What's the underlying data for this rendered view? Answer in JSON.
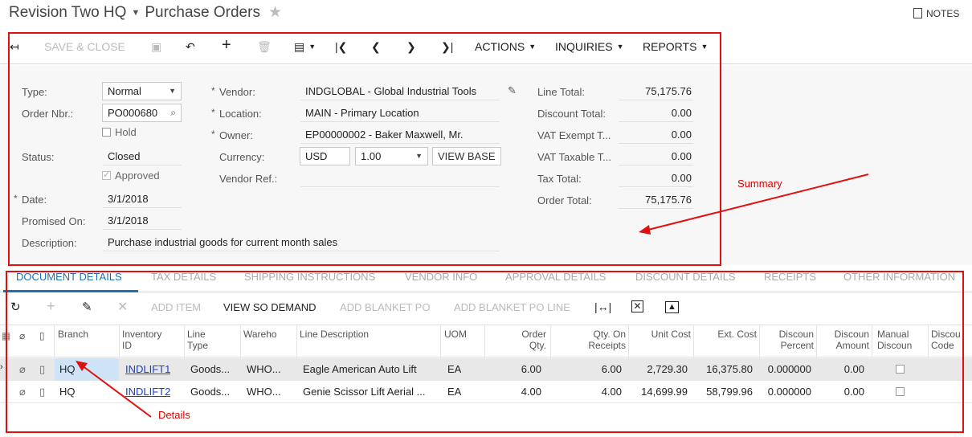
{
  "header": {
    "company": "Revision Two HQ",
    "screen": "Purchase Orders",
    "notes_label": "NOTES"
  },
  "toolbar": {
    "save_close": "SAVE & CLOSE",
    "actions": "ACTIONS",
    "inquiries": "INQUIRIES",
    "reports": "REPORTS"
  },
  "summary": {
    "type_label": "Type:",
    "type_value": "Normal",
    "order_nbr_label": "Order Nbr.:",
    "order_nbr_value": "PO000680",
    "hold_label": "Hold",
    "status_label": "Status:",
    "status_value": "Closed",
    "approved_label": "Approved",
    "date_label": "Date:",
    "date_value": "3/1/2018",
    "promised_label": "Promised On:",
    "promised_value": "3/1/2018",
    "description_label": "Description:",
    "description_value": "Purchase industrial goods for current month sales",
    "vendor_label": "Vendor:",
    "vendor_value": "INDGLOBAL - Global Industrial Tools",
    "location_label": "Location:",
    "location_value": "MAIN - Primary Location",
    "owner_label": "Owner:",
    "owner_value": "EP00000002 - Baker Maxwell, Mr.",
    "currency_label": "Currency:",
    "currency_value": "USD",
    "rate_value": "1.00",
    "view_base": "VIEW BASE",
    "vendor_ref_label": "Vendor Ref.:",
    "line_total_label": "Line Total:",
    "line_total_value": "75,175.76",
    "discount_total_label": "Discount Total:",
    "discount_total_value": "0.00",
    "vat_exempt_label": "VAT Exempt T...",
    "vat_exempt_value": "0.00",
    "vat_taxable_label": "VAT Taxable T...",
    "vat_taxable_value": "0.00",
    "tax_total_label": "Tax Total:",
    "tax_total_value": "0.00",
    "order_total_label": "Order Total:",
    "order_total_value": "75,175.76"
  },
  "tabs": [
    "DOCUMENT DETAILS",
    "TAX DETAILS",
    "SHIPPING INSTRUCTIONS",
    "VENDOR INFO",
    "APPROVAL DETAILS",
    "DISCOUNT DETAILS",
    "RECEIPTS",
    "OTHER INFORMATION"
  ],
  "grid_toolbar": {
    "add_item": "ADD ITEM",
    "view_so_demand": "VIEW SO DEMAND",
    "add_blanket_po": "ADD BLANKET PO",
    "add_blanket_po_line": "ADD BLANKET PO LINE"
  },
  "grid": {
    "headers": [
      "Branch",
      "Inventory\nID",
      "Line\nType",
      "Wareho",
      "Line Description",
      "UOM",
      "Order\nQty.",
      "Qty. On\nReceipts",
      "Unit Cost",
      "Ext. Cost",
      "Discoun\nPercent",
      "Discoun\nAmount",
      "Manual\nDiscoun",
      "Discou\nCode"
    ],
    "rows": [
      {
        "branch": "HQ",
        "inventory_id": "INDLIFT1",
        "line_type": "Goods...",
        "warehouse": "WHO...",
        "description": "Eagle American Auto Lift",
        "uom": "EA",
        "order_qty": "6.00",
        "qty_receipts": "6.00",
        "unit_cost": "2,729.30",
        "ext_cost": "16,375.80",
        "disc_percent": "0.000000",
        "disc_amount": "0.00"
      },
      {
        "branch": "HQ",
        "inventory_id": "INDLIFT2",
        "line_type": "Goods...",
        "warehouse": "WHO...",
        "description": "Genie Scissor Lift Aerial ...",
        "uom": "EA",
        "order_qty": "4.00",
        "qty_receipts": "4.00",
        "unit_cost": "14,699.99",
        "ext_cost": "58,799.96",
        "disc_percent": "0.000000",
        "disc_amount": "0.00"
      }
    ]
  },
  "annotations": {
    "summary": "Summary",
    "details": "Details"
  }
}
